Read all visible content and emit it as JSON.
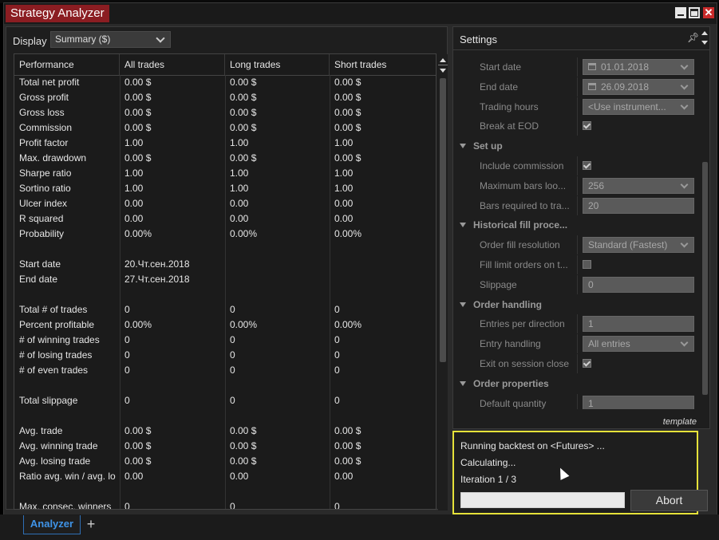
{
  "window": {
    "title": "Strategy Analyzer"
  },
  "display": {
    "label": "Display",
    "selected": "Summary ($)"
  },
  "grid": {
    "columns": [
      "Performance",
      "All trades",
      "Long trades",
      "Short trades"
    ],
    "rows": [
      [
        "Total net profit",
        "0.00 $",
        "0.00 $",
        "0.00 $"
      ],
      [
        "Gross profit",
        "0.00 $",
        "0.00 $",
        "0.00 $"
      ],
      [
        "Gross loss",
        "0.00 $",
        "0.00 $",
        "0.00 $"
      ],
      [
        "Commission",
        "0.00 $",
        "0.00 $",
        "0.00 $"
      ],
      [
        "Profit factor",
        "1.00",
        "1.00",
        "1.00"
      ],
      [
        "Max. drawdown",
        "0.00 $",
        "0.00 $",
        "0.00 $"
      ],
      [
        "Sharpe ratio",
        "1.00",
        "1.00",
        "1.00"
      ],
      [
        "Sortino ratio",
        "1.00",
        "1.00",
        "1.00"
      ],
      [
        "Ulcer index",
        "0.00",
        "0.00",
        "0.00"
      ],
      [
        "R squared",
        "0.00",
        "0.00",
        "0.00"
      ],
      [
        "Probability",
        "0.00%",
        "0.00%",
        "0.00%"
      ],
      [
        "",
        "",
        "",
        ""
      ],
      [
        "Start date",
        "20.Чт.сен.2018",
        "",
        ""
      ],
      [
        "End date",
        "27.Чт.сен.2018",
        "",
        ""
      ],
      [
        "",
        "",
        "",
        ""
      ],
      [
        "Total # of trades",
        "0",
        "0",
        "0"
      ],
      [
        "Percent profitable",
        "0.00%",
        "0.00%",
        "0.00%"
      ],
      [
        "# of winning trades",
        "0",
        "0",
        "0"
      ],
      [
        "# of losing trades",
        "0",
        "0",
        "0"
      ],
      [
        "# of even trades",
        "0",
        "0",
        "0"
      ],
      [
        "",
        "",
        "",
        ""
      ],
      [
        "Total slippage",
        "0",
        "0",
        "0"
      ],
      [
        "",
        "",
        "",
        ""
      ],
      [
        "Avg. trade",
        "0.00 $",
        "0.00 $",
        "0.00 $"
      ],
      [
        "Avg. winning trade",
        "0.00 $",
        "0.00 $",
        "0.00 $"
      ],
      [
        "Avg. losing trade",
        "0.00 $",
        "0.00 $",
        "0.00 $"
      ],
      [
        "Ratio avg. win / avg. lo",
        "0.00",
        "0.00",
        "0.00"
      ],
      [
        "",
        "",
        "",
        ""
      ],
      [
        "Max. consec. winners",
        "0",
        "0",
        "0"
      ]
    ]
  },
  "settings": {
    "title": "Settings",
    "pin_icon": "pin-icon",
    "items": [
      {
        "kind": "prop",
        "label": "Start date",
        "type": "date",
        "value": "01.01.2018"
      },
      {
        "kind": "prop",
        "label": "End date",
        "type": "date",
        "value": "26.09.2018"
      },
      {
        "kind": "prop",
        "label": "Trading hours",
        "type": "select",
        "value": "<Use instrument..."
      },
      {
        "kind": "prop",
        "label": "Break at EOD",
        "type": "check",
        "value": "checked"
      },
      {
        "kind": "section",
        "label": "Set up"
      },
      {
        "kind": "prop",
        "label": "Include commission",
        "type": "check",
        "value": "checked"
      },
      {
        "kind": "prop",
        "label": "Maximum bars loo...",
        "type": "select",
        "value": "256"
      },
      {
        "kind": "prop",
        "label": "Bars required to tra...",
        "type": "text",
        "value": "20"
      },
      {
        "kind": "section",
        "label": "Historical fill proce..."
      },
      {
        "kind": "prop",
        "label": "Order fill resolution",
        "type": "select",
        "value": "Standard (Fastest)"
      },
      {
        "kind": "prop",
        "label": "Fill limit orders on t...",
        "type": "check",
        "value": "unchecked"
      },
      {
        "kind": "prop",
        "label": "Slippage",
        "type": "text",
        "value": "0"
      },
      {
        "kind": "section",
        "label": "Order handling"
      },
      {
        "kind": "prop",
        "label": "Entries per direction",
        "type": "text",
        "value": "1"
      },
      {
        "kind": "prop",
        "label": "Entry handling",
        "type": "select",
        "value": "All entries"
      },
      {
        "kind": "prop",
        "label": "Exit on session close",
        "type": "check",
        "value": "checked"
      },
      {
        "kind": "section",
        "label": "Order properties"
      },
      {
        "kind": "prop",
        "label": "Default quantity",
        "type": "text",
        "value": "1"
      }
    ],
    "template_link": "template"
  },
  "progress": {
    "line1": "Running backtest on <Futures> ...",
    "line2": "Calculating...",
    "line3": "Iteration 1 / 3",
    "fraction": 0,
    "abort_label": "Abort",
    "border_color": "#e6e23a"
  },
  "tabs": {
    "active": "Analyzer",
    "add_icon": "+"
  }
}
